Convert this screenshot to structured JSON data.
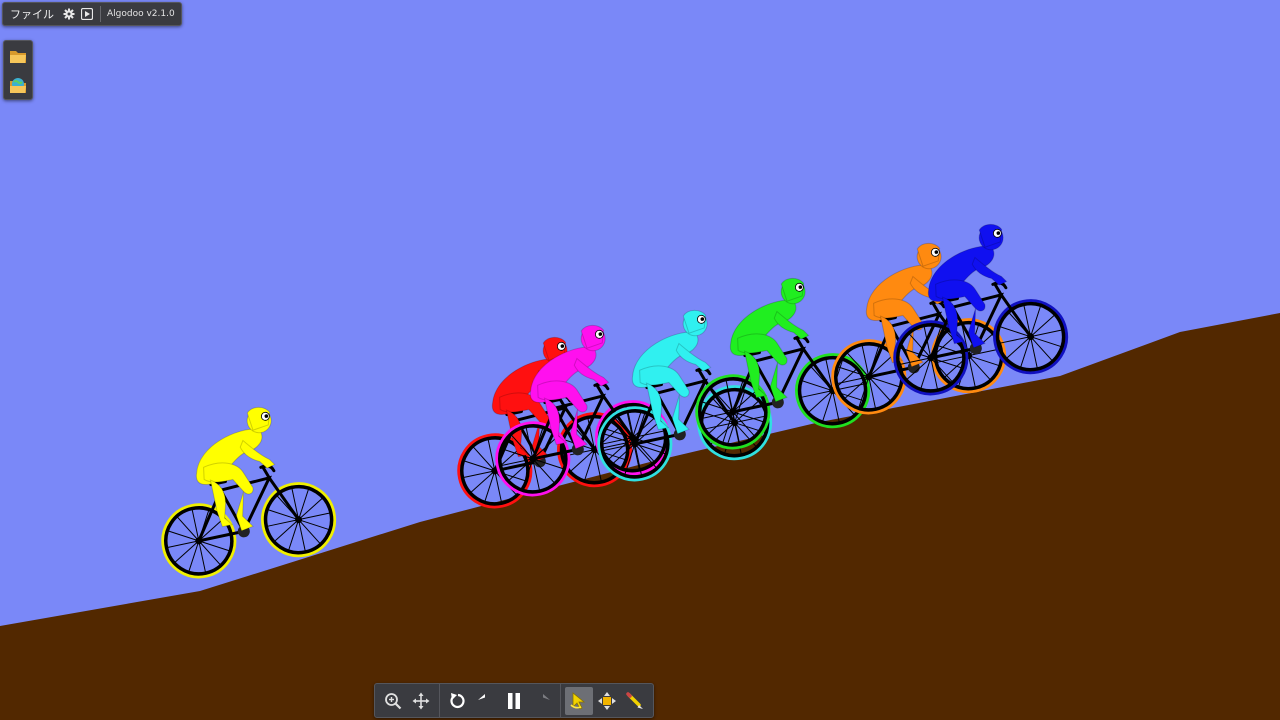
{
  "app": {
    "menu_file": "ファイル",
    "version": "Algodoo v2.1.0"
  },
  "colors": {
    "sky": "#7a88f8",
    "ground": "#522800",
    "toolbar_bg": "#3a3b40"
  },
  "topbar": {
    "icons": [
      "gear-icon",
      "play-scene-icon"
    ]
  },
  "sidebar": {
    "items": [
      {
        "name": "open-folder-icon"
      },
      {
        "name": "browse-scenes-icon"
      }
    ]
  },
  "bottom_toolbar": {
    "items": [
      {
        "name": "zoom-icon",
        "active": false
      },
      {
        "name": "pan-icon",
        "active": false
      },
      {
        "name": "reset-icon",
        "active": false
      },
      {
        "name": "undo-icon",
        "active": false
      },
      {
        "name": "pause-icon",
        "active": false
      },
      {
        "name": "redo-icon",
        "active": false
      },
      {
        "name": "drag-tool-icon",
        "active": true
      },
      {
        "name": "move-tool-icon",
        "active": false
      },
      {
        "name": "sketch-tool-icon",
        "active": false
      }
    ]
  },
  "riders": [
    {
      "name": "yellow",
      "color": "#ffff00",
      "tire": "#f0f000"
    },
    {
      "name": "red",
      "color": "#ff1010",
      "tire": "#ff1010"
    },
    {
      "name": "magenta",
      "color": "#ff10ee",
      "tire": "#ff10ee"
    },
    {
      "name": "cyan",
      "color": "#30f0f0",
      "tire": "#30e0e0"
    },
    {
      "name": "green",
      "color": "#20ee20",
      "tire": "#20e020"
    },
    {
      "name": "orange",
      "color": "#ff8a10",
      "tire": "#ff8a10"
    },
    {
      "name": "blue",
      "color": "#1010f0",
      "tire": "#1010c0"
    }
  ]
}
